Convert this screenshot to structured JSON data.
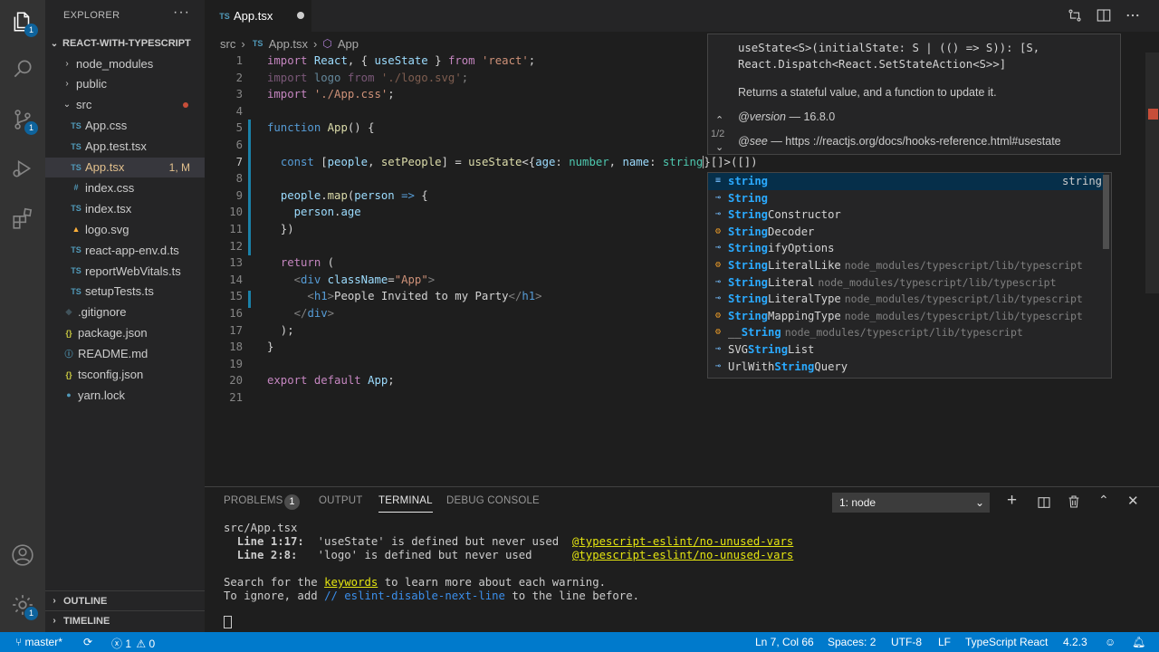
{
  "activity": {
    "explorer_badge": "1",
    "scm_badge": "1",
    "settings_badge": "1"
  },
  "sidebar": {
    "title": "EXPLORER",
    "more": "···",
    "root": "REACT-WITH-TYPESCRIPT",
    "items": [
      {
        "kind": "folder-closed",
        "label": "node_modules"
      },
      {
        "kind": "folder-closed",
        "label": "public"
      },
      {
        "kind": "folder-open",
        "label": "src"
      },
      {
        "kind": "ts",
        "icon": "TS",
        "label": "App.css"
      },
      {
        "kind": "ts",
        "icon": "TS",
        "label": "App.test.tsx"
      },
      {
        "kind": "ts",
        "icon": "TS",
        "label": "App.tsx",
        "status": "1, M"
      },
      {
        "kind": "css",
        "icon": "#",
        "label": "index.css"
      },
      {
        "kind": "ts",
        "icon": "TS",
        "label": "index.tsx"
      },
      {
        "kind": "svg",
        "icon": "▲",
        "label": "logo.svg"
      },
      {
        "kind": "ts",
        "icon": "TS",
        "label": "react-app-env.d.ts"
      },
      {
        "kind": "ts",
        "icon": "TS",
        "label": "reportWebVitals.ts"
      },
      {
        "kind": "ts",
        "icon": "TS",
        "label": "setupTests.ts"
      },
      {
        "kind": "git",
        "icon": "◆",
        "label": ".gitignore"
      },
      {
        "kind": "json",
        "icon": "{}",
        "label": "package.json"
      },
      {
        "kind": "md",
        "icon": "ⓘ",
        "label": "README.md"
      },
      {
        "kind": "json",
        "icon": "{}",
        "label": "tsconfig.json"
      },
      {
        "kind": "yarn",
        "icon": "●",
        "label": "yarn.lock"
      }
    ],
    "outline": "OUTLINE",
    "timeline": "TIMELINE"
  },
  "tab": {
    "icon": "TS",
    "label": "App.tsx"
  },
  "breadcrumb": {
    "folder": "src",
    "file_icon": "TS",
    "file": "App.tsx",
    "symbol": "App"
  },
  "editor": {
    "line_numbers": [
      "1",
      "2",
      "3",
      "4",
      "5",
      "6",
      "7",
      "8",
      "9",
      "10",
      "11",
      "12",
      "13",
      "14",
      "15",
      "16",
      "17",
      "18",
      "19",
      "20",
      "21"
    ],
    "current_line": "7"
  },
  "hover": {
    "signature_1": "useState<S>(initialState: S | (() => S)): [S,",
    "signature_2": "React.Dispatch<React.SetStateAction<S>>]",
    "description": "Returns a stateful value, and a function to update it.",
    "version_label": "@version",
    "version_value": "— 16.8.0",
    "see_label": "@see",
    "see_value": "— https ://reactjs.org/docs/hooks-reference.html#usestate",
    "pager": "1/2"
  },
  "suggest": {
    "items": [
      {
        "pre": "",
        "match": "string",
        "post": "",
        "detail": "",
        "type": "string",
        "icon": "keyword"
      },
      {
        "pre": "",
        "match": "String",
        "post": "",
        "detail": "",
        "type": "",
        "icon": "interface"
      },
      {
        "pre": "",
        "match": "String",
        "post": "Constructor",
        "detail": "",
        "type": "",
        "icon": "interface"
      },
      {
        "pre": "",
        "match": "String",
        "post": "Decoder",
        "detail": "",
        "type": "",
        "icon": "class"
      },
      {
        "pre": "",
        "match": "String",
        "post": "ifyOptions",
        "detail": "",
        "type": "",
        "icon": "interface"
      },
      {
        "pre": "",
        "match": "String",
        "post": "LiteralLike",
        "detail": "node_modules/typescript/lib/typescript",
        "type": "",
        "icon": "class"
      },
      {
        "pre": "",
        "match": "String",
        "post": "Literal",
        "detail": "node_modules/typescript/lib/typescript",
        "type": "",
        "icon": "interface"
      },
      {
        "pre": "",
        "match": "String",
        "post": "LiteralType",
        "detail": "node_modules/typescript/lib/typescript",
        "type": "",
        "icon": "interface"
      },
      {
        "pre": "",
        "match": "String",
        "post": "MappingType",
        "detail": "node_modules/typescript/lib/typescript",
        "type": "",
        "icon": "class"
      },
      {
        "pre": "__",
        "match": "String",
        "post": "",
        "detail": "node_modules/typescript/lib/typescript",
        "type": "",
        "icon": "class"
      },
      {
        "pre": "SVG",
        "match": "String",
        "post": "List",
        "detail": "",
        "type": "",
        "icon": "interface"
      },
      {
        "pre": "UrlWith",
        "match": "String",
        "post": "Query",
        "detail": "",
        "type": "",
        "icon": "interface"
      }
    ]
  },
  "panel": {
    "tabs": {
      "problems": "PROBLEMS",
      "problems_count": "1",
      "output": "OUTPUT",
      "terminal": "TERMINAL",
      "debug": "DEBUG CONSOLE"
    },
    "terminal_select": "1: node",
    "terminal": {
      "file": "src/App.tsx",
      "l1_loc": "  Line 1:17:",
      "l1_msg": "  'useState' is defined but never used  ",
      "l1_rule": "@typescript-eslint/no-unused-vars",
      "l2_loc": "  Line 2:8:",
      "l2_msg": "   'logo' is defined but never used      ",
      "l2_rule": "@typescript-eslint/no-unused-vars",
      "search_pre": "Search for the ",
      "search_kw": "keywords",
      "search_post": " to learn more about each warning.",
      "ignore_pre": "To ignore, add ",
      "ignore_kw": "// eslint-disable-next-line",
      "ignore_post": " to the line before."
    }
  },
  "status": {
    "branch": "master*",
    "errors": "1",
    "warnings": "0",
    "position": "Ln 7, Col 66",
    "spaces": "Spaces: 2",
    "encoding": "UTF-8",
    "eol": "LF",
    "language": "TypeScript React",
    "version": "4.2.3"
  },
  "colors": {
    "accent": "#007acc",
    "activity": "#333333",
    "sidebar": "#252526",
    "editor": "#1e1e1e"
  }
}
